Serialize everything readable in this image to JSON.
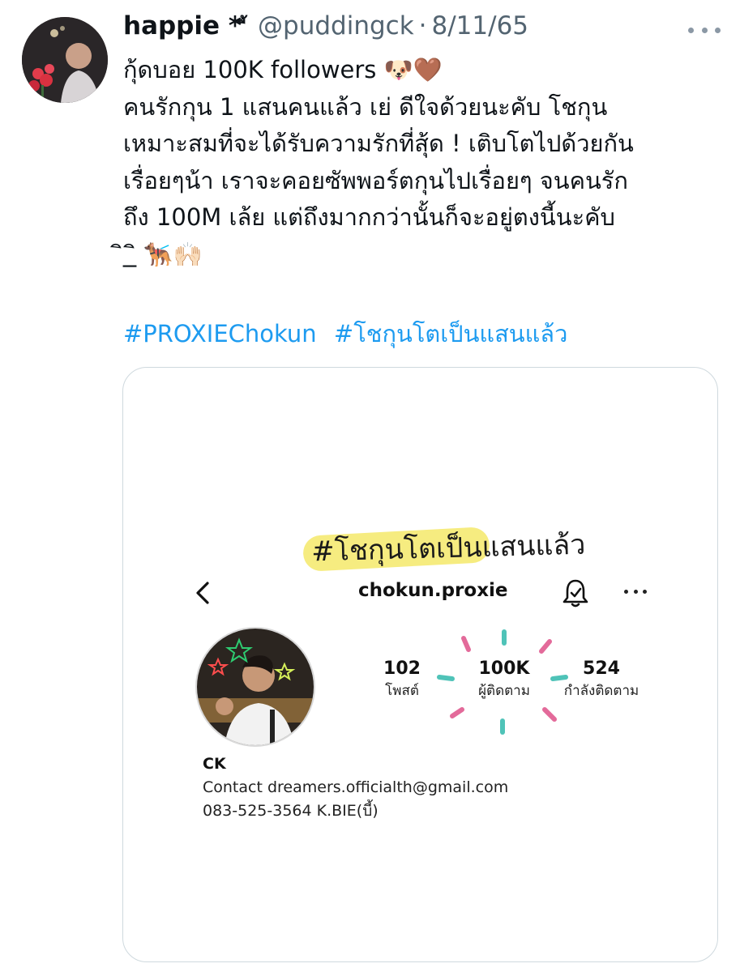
{
  "tweet": {
    "display_name": "happie *",
    "name_decoration": "ี้",
    "handle": "@puddingck",
    "separator": "·",
    "date": "8/11/65",
    "body_lines": [
      "กุ้ดบอย 100K followers 🐶🤎",
      "คนรักกุน 1 แสนคนแล้ว เย่ ดีใจด้วยนะคับ โชกุน",
      "เหมาะสมที่จะได้รับความรักที่สุ้ด ! เติบโตไปด้วยกัน",
      "เรื่อยๆน้า เราจะคอยซัพพอร์ตกุนไปเรื่อยๆ จนคนรัก",
      "ถึง 100M เล้ย แต่ถึงมากกว่านั้นก็จะอยู่ตงนี้นะคับ",
      "ิ_ิ 🐕‍🦺🙌🏻"
    ],
    "hashtags": [
      "#PROXIEChokun",
      "#โชกุนโตเป็นแสนแล้ว"
    ]
  },
  "media": {
    "headline": "#โชกุนโตเป็นแสนแล้ว",
    "profile": {
      "username": "chokun.proxie",
      "stats": {
        "posts": {
          "value": "102",
          "label": "โพสต์"
        },
        "followers": {
          "value": "100K",
          "label": "ผู้ติดตาม"
        },
        "following": {
          "value": "524",
          "label": "กำลังติดตาม"
        }
      },
      "bio": {
        "name": "CK",
        "contact": "Contact dreamers.officialth@gmail.com",
        "phone": "083-525-3564 K.BIE(บี้)"
      }
    }
  },
  "colors": {
    "hashtag": "#1d9bf0",
    "secondary_text": "#536471",
    "highlight": "#f4e96a",
    "burst_pink": "#e36a9a",
    "burst_teal": "#4fc3b8"
  },
  "icons": {
    "more": "more-horizontal-icon",
    "back": "chevron-left-icon",
    "bell": "notification-bell-icon"
  }
}
